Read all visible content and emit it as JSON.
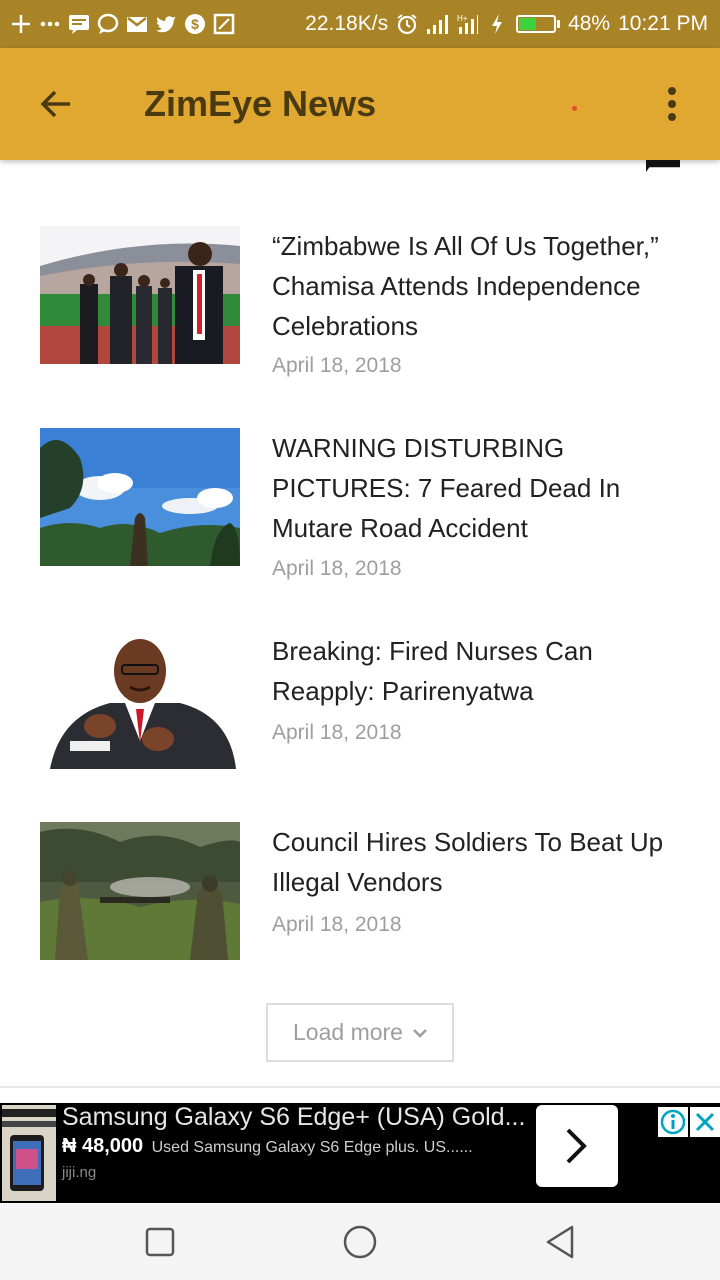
{
  "status_bar": {
    "network_speed": "22.18K/s",
    "battery_percent": "48%",
    "battery_level": 0.48,
    "time": "10:21 PM",
    "left_icons": [
      "plus-icon",
      "more-icon",
      "message-icon",
      "chat-icon",
      "gmail-icon",
      "twitter-icon",
      "app-icon",
      "screenshot-icon"
    ],
    "right_icons": [
      "alarm-icon",
      "signal-icon",
      "data-signal-icon",
      "charging-icon",
      "battery-icon"
    ]
  },
  "app_bar": {
    "title": "ZimEye News",
    "back_icon": "arrow-back-icon",
    "menu_icon": "more-vert-icon",
    "background": "#e0a830",
    "title_color": "#4a3a12"
  },
  "articles": [
    {
      "title": "“Zimbabwe Is All Of Us Together,” Chamisa Attends Independence Celebrations",
      "date": "April 18, 2018"
    },
    {
      "title": "WARNING DISTURBING PICTURES: 7 Feared Dead In Mutare Road Accident",
      "date": "April 18, 2018"
    },
    {
      "title": "Breaking: Fired Nurses Can Reapply: Parirenyatwa",
      "date": "April 18, 2018"
    },
    {
      "title": "Council Hires Soldiers To Beat Up Illegal Vendors",
      "date": "April 18, 2018"
    }
  ],
  "load_more": {
    "label": "Load more",
    "icon": "chevron-down-icon"
  },
  "ad": {
    "title": "Samsung Galaxy S6 Edge+ (USA) Gold...",
    "price": "₦ 48,000",
    "description": "Used Samsung Galaxy S6 Edge plus. US......",
    "domain": "jiji.ng",
    "arrow_icon": "chevron-right-icon",
    "info_icon": "info-icon",
    "close_icon": "close-icon"
  },
  "nav_bar": {
    "recents_icon": "square-icon",
    "home_icon": "circle-icon",
    "back_icon": "triangle-back-icon"
  }
}
